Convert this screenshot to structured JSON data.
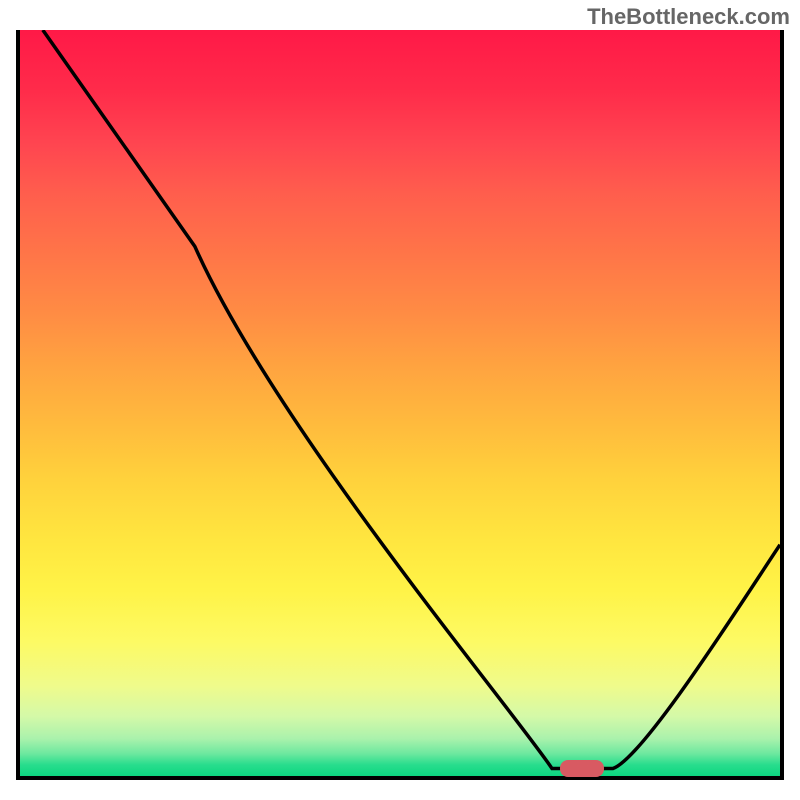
{
  "watermark": "TheBottleneck.com",
  "chart_data": {
    "type": "line",
    "title": "",
    "xlabel": "",
    "ylabel": "",
    "xlim": [
      0,
      100
    ],
    "ylim": [
      0,
      100
    ],
    "grid": false,
    "curve_points": [
      {
        "x": 3,
        "y": 100
      },
      {
        "x": 23,
        "y": 71
      },
      {
        "x": 70,
        "y": 1
      },
      {
        "x": 78,
        "y": 1
      },
      {
        "x": 100,
        "y": 31
      }
    ],
    "marker": {
      "x": 74,
      "y": 1,
      "color": "#d85a62"
    },
    "gradient_stops": [
      {
        "pos": 0,
        "color": "#ff1947"
      },
      {
        "pos": 50,
        "color": "#ffc23d"
      },
      {
        "pos": 80,
        "color": "#fffa55"
      },
      {
        "pos": 100,
        "color": "#0cd680"
      }
    ]
  }
}
